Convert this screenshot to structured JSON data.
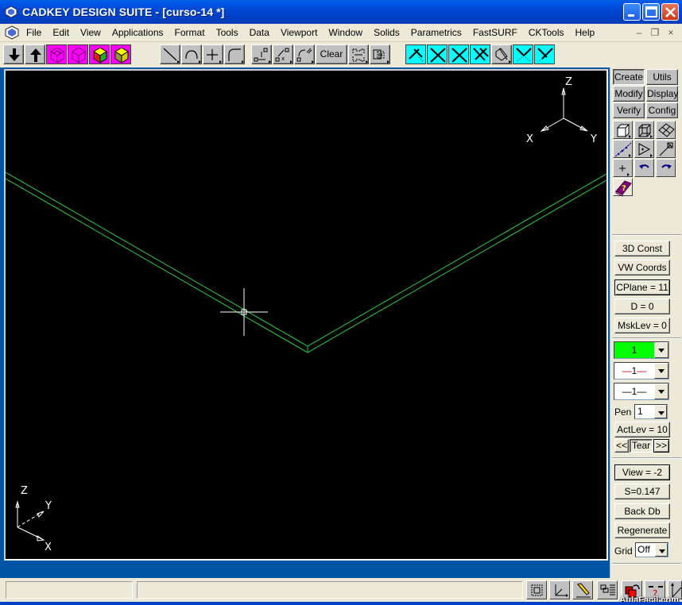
{
  "window": {
    "title": "CADKEY DESIGN SUITE - [curso-14 *]"
  },
  "menu": {
    "items": [
      "File",
      "Edit",
      "View",
      "Applications",
      "Format",
      "Tools",
      "Data",
      "Viewport",
      "Window",
      "Solids",
      "Parametrics",
      "FastSURF",
      "CKTools",
      "Help"
    ]
  },
  "toolbar": {
    "groups": [
      {
        "icons": [
          "arrow-down-icon",
          "arrow-up-icon"
        ]
      },
      {
        "icons": [
          "wireframe-cube-icon",
          "wireframe-cube-alt-icon",
          "shaded-cube-icon",
          "shaded-cube-yellow-icon"
        ]
      },
      {
        "icons": [
          "line-icon",
          "arc-icon",
          "point-icon",
          "fillet-icon"
        ]
      },
      {
        "icons": [
          "move-icon",
          "copy-icon",
          "transform-icon"
        ]
      },
      {
        "icons": [
          "select-window-icon",
          "select-group-icon"
        ]
      },
      {
        "icons": [
          "trim-icon",
          "intersect-icon",
          "intersect-alt-icon",
          "extend-icon",
          "break-icon",
          "trim-dotted-icon",
          "trim-dotted-alt-icon"
        ]
      }
    ],
    "clear_label": "Clear"
  },
  "viewport": {
    "view_axes": {
      "z": "Z",
      "x": "X",
      "y": "Y"
    },
    "world_axes": {
      "z": "Z",
      "x": "X",
      "y": "Y"
    },
    "geometry_color": "#2ecc40"
  },
  "rpanel": {
    "tabs": [
      "Create",
      "Utils",
      "Modify",
      "Display",
      "Verify",
      "Config"
    ],
    "const_mode": "3D Const",
    "coords_mode": "VW Coords",
    "cplane": "CPlane = 11",
    "depth": "D = 0",
    "mask_level": "MskLev =  0",
    "color_value": "1",
    "color_swatch": "#00ff00",
    "line_type_value": "1",
    "line_width_value": "1",
    "pen_label": "Pen",
    "pen_value": "1",
    "active_level": "ActLev = 10",
    "prev_label": "<<",
    "tear_label": "Tear",
    "next_label": ">>",
    "view": "View = -2",
    "scale": "S=0.147",
    "back_db": "Back Db",
    "regenerate": "Regenerate",
    "grid_label": "Grid",
    "grid_value": "Off"
  },
  "statusbar": {
    "field1": "",
    "field2": "",
    "icons": [
      "zoom-window-icon",
      "axis-icon",
      "pencil-icon",
      "layers-icon",
      "redraw-icon",
      "help-query-icon",
      "axis-up-icon"
    ]
  },
  "watermark": "AulaFacil.com"
}
